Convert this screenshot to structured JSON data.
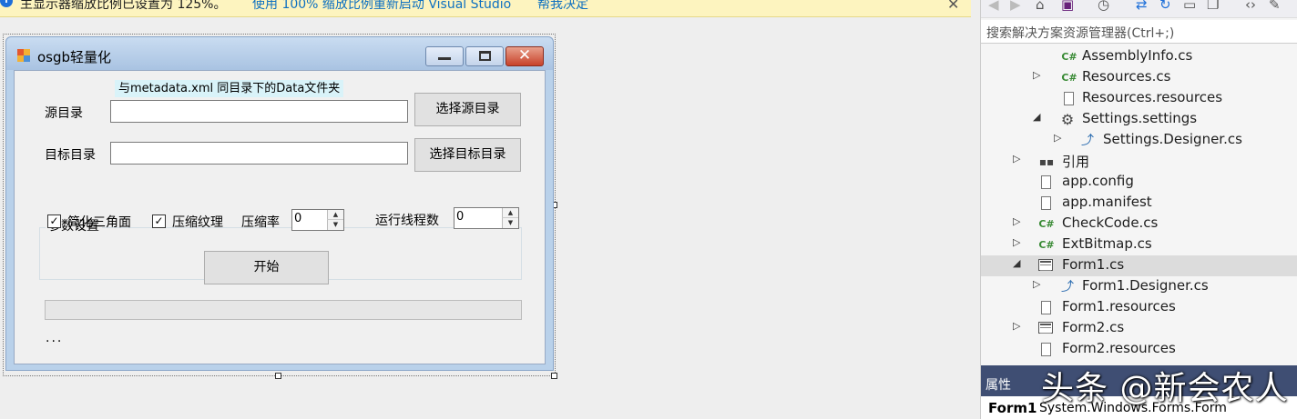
{
  "infobar": {
    "message": "主显示器缩放比例已设置为 125%。",
    "link_restart": "使用 100% 缩放比例重新启动 Visual Studio",
    "link_help": "帮我决定",
    "close": "✕"
  },
  "form": {
    "title": "osgb轻量化",
    "hint": "与metadata.xml  同目录下的Data文件夹",
    "source_label": "源目录",
    "source_value": "",
    "source_button": "选择源目录",
    "target_label": "目标目录",
    "target_value": "",
    "target_button": "选择目标目录",
    "group_title": "参数设置",
    "simplify_label": "简化三角面",
    "compress_texture_label": "压缩纹理",
    "ratio_label": "压缩率",
    "ratio_value": "0",
    "threads_label": "运行线程数",
    "threads_value": "0",
    "start_button": "开始",
    "status": "...",
    "progress": 0
  },
  "solution_explorer": {
    "search_placeholder": "搜索解决方案资源管理器(Ctrl+;)",
    "items": [
      {
        "label": "AssemblyInfo.cs",
        "icon": "csharp-file-icon"
      },
      {
        "label": "Resources.cs",
        "icon": "csharp-file-icon"
      },
      {
        "label": "Resources.resources",
        "icon": "file-icon"
      },
      {
        "label": "Settings.settings",
        "icon": "settings-icon"
      },
      {
        "label": "Settings.Designer.cs",
        "icon": "designer-file-icon"
      },
      {
        "label": "引用",
        "icon": "references-icon"
      },
      {
        "label": "app.config",
        "icon": "config-file-icon"
      },
      {
        "label": "app.manifest",
        "icon": "manifest-file-icon"
      },
      {
        "label": "CheckCode.cs",
        "icon": "csharp-file-icon"
      },
      {
        "label": "ExtBitmap.cs",
        "icon": "csharp-file-icon"
      },
      {
        "label": "Form1.cs",
        "icon": "form-icon"
      },
      {
        "label": "Form1.Designer.cs",
        "icon": "designer-file-icon"
      },
      {
        "label": "Form1.resources",
        "icon": "file-icon"
      },
      {
        "label": "Form2.cs",
        "icon": "form-icon"
      },
      {
        "label": "Form2.resources",
        "icon": "file-icon"
      }
    ]
  },
  "properties": {
    "title": "属性",
    "object_name": "Form1",
    "object_type": "System.Windows.Forms.Form"
  },
  "watermark": "头条 @新会农人"
}
